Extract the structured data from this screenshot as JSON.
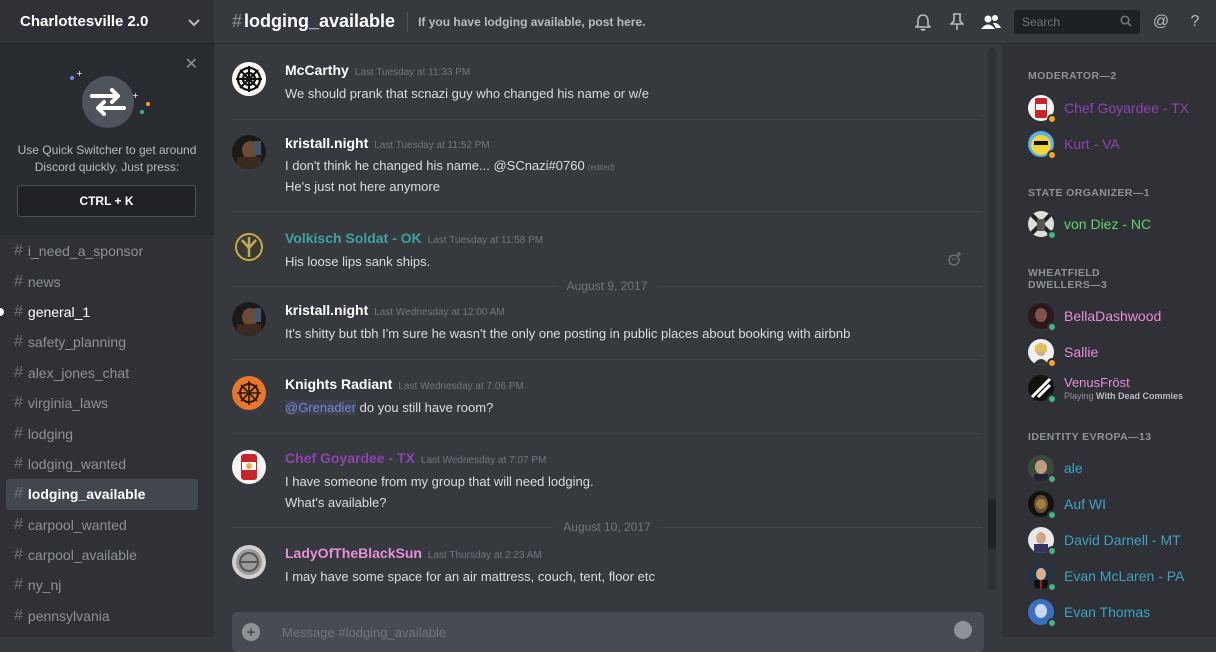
{
  "guild": {
    "name": "Charlottesville 2.0"
  },
  "quick_switcher": {
    "text": "Use Quick Switcher to get around Discord quickly. Just press:",
    "shortcut": "CTRL + K"
  },
  "channels": [
    {
      "name": "i_need_a_sponsor"
    },
    {
      "name": "news"
    },
    {
      "name": "general_1"
    },
    {
      "name": "safety_planning"
    },
    {
      "name": "alex_jones_chat"
    },
    {
      "name": "virginia_laws"
    },
    {
      "name": "lodging"
    },
    {
      "name": "lodging_wanted"
    },
    {
      "name": "lodging_available"
    },
    {
      "name": "carpool_wanted"
    },
    {
      "name": "carpool_available"
    },
    {
      "name": "ny_nj"
    },
    {
      "name": "pennsylvania"
    }
  ],
  "header": {
    "hash": "#",
    "channel": "lodging_available",
    "topic": "If you have lodging available, post here.",
    "search_placeholder": "Search",
    "icons": [
      "bell-icon",
      "pin-icon",
      "members-icon",
      "search-icon",
      "mention-icon",
      "help-icon"
    ]
  },
  "messages": [
    {
      "author": "McCarthy",
      "color": "#ffffff",
      "time": "Last Tuesday at 11:33 PM",
      "lines": [
        "We should prank that scnazi guy who changed his name or w/e"
      ]
    },
    {
      "author": "kristall.night",
      "color": "#ffffff",
      "time": "Last Tuesday at 11:52 PM",
      "lines": [
        "I don't think he changed his name...  @SCnazi#0760",
        "He's just not here anymore"
      ],
      "edited": "(edited)"
    },
    {
      "author": "Volkisch Soldat - OK",
      "color": "#3fa3a3",
      "time": "Last Tuesday at 11:58 PM",
      "lines": [
        "His loose lips sank ships."
      ]
    },
    {
      "date": "August 9, 2017"
    },
    {
      "author": "kristall.night",
      "color": "#ffffff",
      "time": "Last Wednesday at 12:00 AM",
      "lines": [
        "It's shitty but tbh I'm sure he wasn't the only one posting in public places about booking with airbnb"
      ]
    },
    {
      "author": "Knights Radiant",
      "color": "#ffffff",
      "time": "Last Wednesday at 7:06 PM",
      "mention": "@Grenadier",
      "lines": [
        " do you still have room?"
      ]
    },
    {
      "author": "Chef Goyardee - TX",
      "color": "#8e44ad",
      "time": "Last Wednesday at 7:07 PM",
      "lines": [
        "I have someone from my group that will need lodging.",
        "What's available?"
      ]
    },
    {
      "date": "August 10, 2017"
    },
    {
      "author": "LadyOfTheBlackSun",
      "color": "#e78fd7",
      "time": "Last Thursday at 2:23 AM",
      "lines": [
        "I may have some space for an air mattress, couch, tent, floor etc"
      ]
    }
  ],
  "composer": {
    "placeholder": "Message #lodging_available"
  },
  "member_groups": [
    {
      "title": "MODERATOR—2",
      "members": [
        {
          "name": "Chef Goyardee - TX",
          "color": "#8e44ad",
          "status": "idle"
        },
        {
          "name": "Kurt - VA",
          "color": "#8e44ad",
          "status": "idle"
        }
      ]
    },
    {
      "title": "STATE ORGANIZER—1",
      "members": [
        {
          "name": "von Diez - NC",
          "color": "#63d471",
          "status": "online"
        }
      ]
    },
    {
      "title": "WHEATFIELD DWELLERS—3",
      "members": [
        {
          "name": "BellaDashwood",
          "color": "#e78fd7",
          "status": "online"
        },
        {
          "name": "Sallie",
          "color": "#e78fd7",
          "status": "idle"
        },
        {
          "name": "VenusFröst",
          "color": "#e78fd7",
          "status": "online",
          "activity_prefix": "Playing",
          "activity": "With Dead Commies"
        }
      ]
    },
    {
      "title": "IDENTITY EVROPA—13",
      "members": [
        {
          "name": "ale",
          "color": "#3fa3c3",
          "status": "online"
        },
        {
          "name": "Auf WI",
          "color": "#3fa3c3",
          "status": "online"
        },
        {
          "name": "David Darnell - MT",
          "color": "#3fa3c3",
          "status": "online"
        },
        {
          "name": "Evan McLaren - PA",
          "color": "#3fa3c3",
          "status": "online"
        },
        {
          "name": "Evan Thomas",
          "color": "#3fa3c3",
          "status": "online"
        }
      ]
    }
  ]
}
